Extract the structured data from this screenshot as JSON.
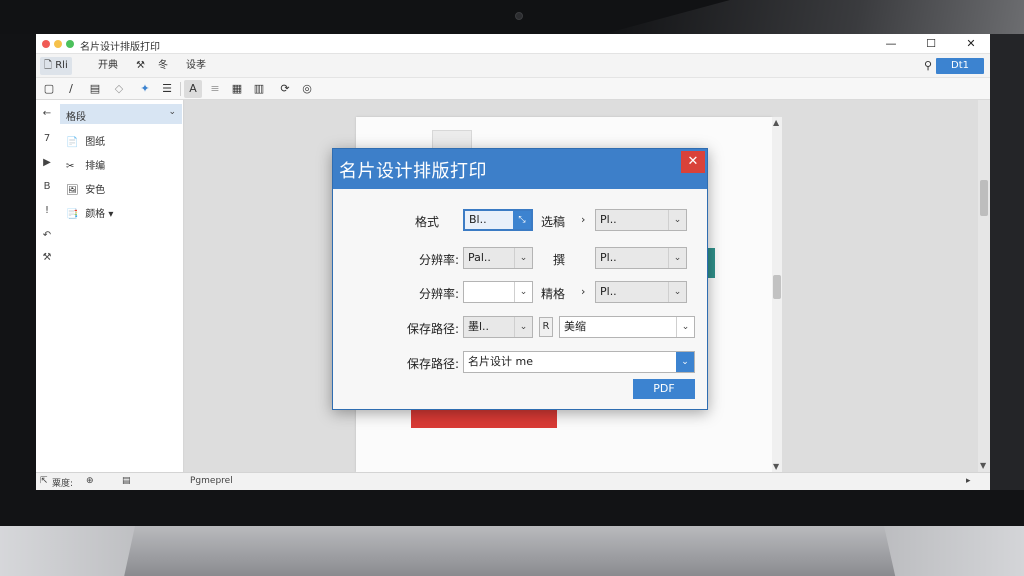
{
  "window": {
    "title": "名片设计排版打印",
    "minimize_glyph": "—",
    "maximize_glyph": "☐",
    "close_glyph": "✕"
  },
  "menubar": {
    "items": [
      {
        "label": "Rli"
      },
      {
        "label": "开典"
      },
      {
        "label": "冬"
      },
      {
        "label": "设孝"
      }
    ],
    "login_label": "Dt1"
  },
  "sidebar": {
    "header_label": "格段",
    "items": [
      {
        "gutter": "7",
        "icon": "📄",
        "label": "图纸"
      },
      {
        "gutter": "▶",
        "icon": "✂",
        "label": "排编"
      },
      {
        "gutter": "B",
        "icon": "🖼",
        "label": "安色"
      },
      {
        "gutter": "!",
        "icon": "📑",
        "label": "颜格 ▾"
      }
    ]
  },
  "dialog": {
    "title": "名片设计排版打印",
    "close_glyph": "✕",
    "rows": [
      {
        "label": "格式",
        "left_value": "Bl..",
        "mid_label": "选稿",
        "right_value": "Pl.."
      },
      {
        "label": "分辨率:",
        "left_value": "Pal..",
        "mid_label": "撰",
        "right_value": "Pl.."
      },
      {
        "label": "分辨率:",
        "left_value": "",
        "mid_label": "精格",
        "right_value": "Pl.."
      }
    ],
    "save_row": {
      "label": "保存路径:",
      "left_value": "墨l..",
      "button": "R",
      "right_value": "美缩"
    },
    "path_row": {
      "label": "保存路径:",
      "value": "名片设计 me"
    },
    "pdf_label": "PDF"
  },
  "statusbar": {
    "left_text": "粟度:",
    "mid_text": "Pgmeprel"
  },
  "colors": {
    "accent": "#3c83d0",
    "dialog_title": "#3d7fc9",
    "close": "#d9423a",
    "card_red": "#d93a35",
    "card_teal": "#2f8f8a"
  }
}
